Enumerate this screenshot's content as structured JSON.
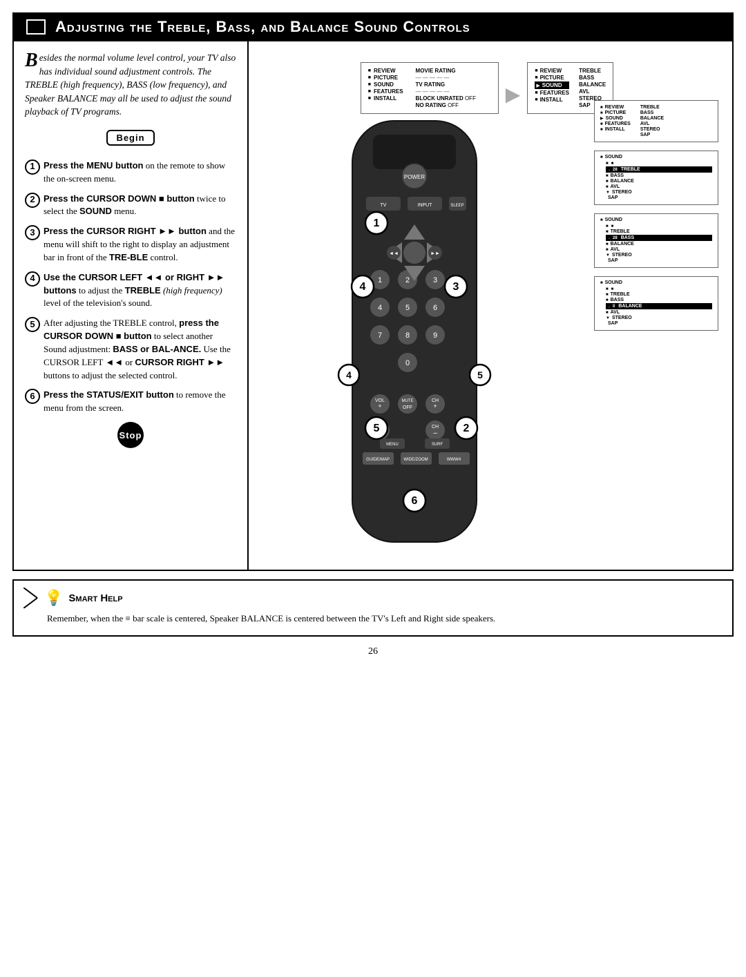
{
  "header": {
    "title": "Adjusting the Treble, Bass, and Balance Sound Controls"
  },
  "intro": {
    "drop_cap": "B",
    "text": "esides the normal volume level control, your TV also has individual sound adjustment controls. The TREBLE (high frequency), BASS (low frequency), and Speaker BALANCE may all be used to adjust the sound playback of TV programs."
  },
  "begin_label": "Begin",
  "stop_label": "Stop",
  "steps": [
    {
      "num": "1",
      "text_parts": [
        {
          "bold": true,
          "text": "Press the MENU button"
        },
        {
          "bold": false,
          "text": " on the remote to show the on-screen menu."
        }
      ]
    },
    {
      "num": "2",
      "text_parts": [
        {
          "bold": true,
          "text": "Press the CURSOR DOWN ■ button"
        },
        {
          "bold": false,
          "text": " twice to select the "
        },
        {
          "bold": true,
          "text": "SOUND"
        },
        {
          "bold": false,
          "text": " menu."
        }
      ]
    },
    {
      "num": "3",
      "text_parts": [
        {
          "bold": true,
          "text": "Press the CURSOR RIGHT ►► button"
        },
        {
          "bold": false,
          "text": " and the menu will shift to the right to display an adjustment bar in front of the "
        },
        {
          "bold": true,
          "text": "TRE-BLE"
        },
        {
          "bold": false,
          "text": " control."
        }
      ]
    },
    {
      "num": "4",
      "text_parts": [
        {
          "bold": true,
          "text": "Use the CURSOR LEFT ◄◄ or RIGHT ►► buttons"
        },
        {
          "bold": false,
          "text": " to adjust the "
        },
        {
          "bold": true,
          "text": "TREBLE"
        },
        {
          "bold": false,
          "text": " (high frequency) level of the television's sound."
        }
      ]
    },
    {
      "num": "5",
      "text_parts": [
        {
          "bold": false,
          "text": "After adjusting the TREBLE control, "
        },
        {
          "bold": true,
          "text": "press the CURSOR DOWN ■ button"
        },
        {
          "bold": false,
          "text": " to select another Sound adjustment: "
        },
        {
          "bold": true,
          "text": "BASS or BAL-ANCE."
        },
        {
          "bold": false,
          "text": " Use the CURSOR LEFT ◄◄ or CURSOR RIGHT ►► buttons to adjust the selected control."
        }
      ]
    },
    {
      "num": "6",
      "text_parts": [
        {
          "bold": true,
          "text": "Press the STATUS/EXIT button"
        },
        {
          "bold": false,
          "text": " to remove the menu from the screen."
        }
      ]
    }
  ],
  "smart_help": {
    "title": "Smart Help",
    "text": "Remember, when the ≡ bar scale is centered, Speaker BALANCE is centered between the TV's Left and Right side speakers."
  },
  "menu_boxes": {
    "main_menu": {
      "items": [
        "REVIEW",
        "PICTURE",
        "SOUND",
        "FEATURES",
        "INSTALL"
      ],
      "right_items": [
        "MOVIE RATING",
        "------",
        "TV RATING",
        "------",
        "BLOCK UNRATED  OFF",
        "NO RATING      OFF"
      ]
    }
  },
  "right_menus": [
    {
      "title": "SOUND menu step 1",
      "items": [
        "REVIEW",
        "PICTURE",
        "SOUND",
        "FEATURES",
        "INSTALL"
      ],
      "sub_items": [
        "TREBLE",
        "BASS",
        "BALANCE",
        "AVL",
        "STEREO",
        "SAP"
      ],
      "selected": "TREBLE"
    },
    {
      "title": "SOUND menu step 2",
      "sound_label": "SOUND",
      "bar_value": 28,
      "items": [
        "TREBLE",
        "BASS",
        "BALANCE",
        "AVL",
        "STEREO",
        "SAP"
      ],
      "selected": "TREBLE"
    },
    {
      "title": "SOUND menu step 3",
      "sound_label": "SOUND",
      "bar_value": 28,
      "items": [
        "TREBLE",
        "BASS",
        "BALANCE",
        "AVL",
        "STEREO",
        "SAP"
      ],
      "selected": "BASS"
    },
    {
      "title": "SOUND menu step 4",
      "sound_label": "SOUND",
      "bar_value": 0,
      "items": [
        "TREBLE",
        "BASS",
        "BALANCE",
        "AVL",
        "STEREO",
        "SAP"
      ],
      "selected": "BALANCE"
    }
  ],
  "page_number": "26",
  "colors": {
    "black": "#000000",
    "white": "#ffffff",
    "gray": "#888888",
    "dark_gray": "#333333"
  }
}
